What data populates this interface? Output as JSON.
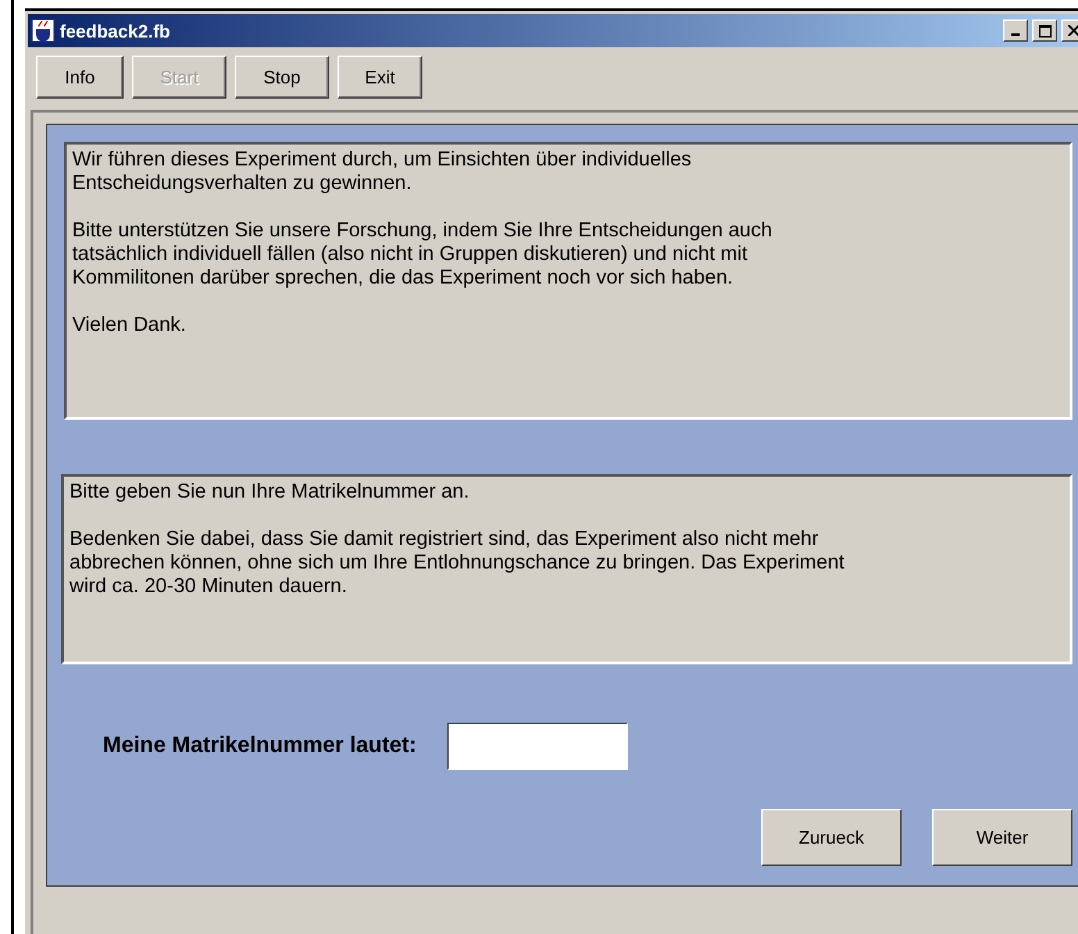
{
  "window": {
    "title": "feedback2.fb"
  },
  "toolbar": [
    {
      "label": "Info",
      "disabled": false
    },
    {
      "label": "Start",
      "disabled": true
    },
    {
      "label": "Stop",
      "disabled": false
    },
    {
      "label": "Exit",
      "disabled": false
    }
  ],
  "intro_text": [
    "Wir führen dieses Experiment durch, um Einsichten über individuelles\nEntscheidungsverhalten zu gewinnen.",
    "Bitte unterstützen Sie unsere Forschung, indem Sie Ihre Entscheidungen auch\ntatsächlich individuell fällen (also nicht in Gruppen diskutieren) und nicht mit\nKommilitonen darüber sprechen, die das Experiment noch vor sich haben.",
    "Vielen Dank."
  ],
  "notice_text": [
    "Bitte geben Sie nun Ihre Matrikelnummer an.",
    "Bedenken Sie dabei, dass Sie damit registriert sind, das Experiment also nicht mehr\nabbrechen können, ohne sich um Ihre Entlohnungschance zu bringen. Das Experiment\nwird ca. 20-30 Minuten dauern."
  ],
  "form": {
    "label": "Meine Matrikelnummer lautet:"
  },
  "buttons": [
    "Zurueck",
    "Weiter"
  ]
}
